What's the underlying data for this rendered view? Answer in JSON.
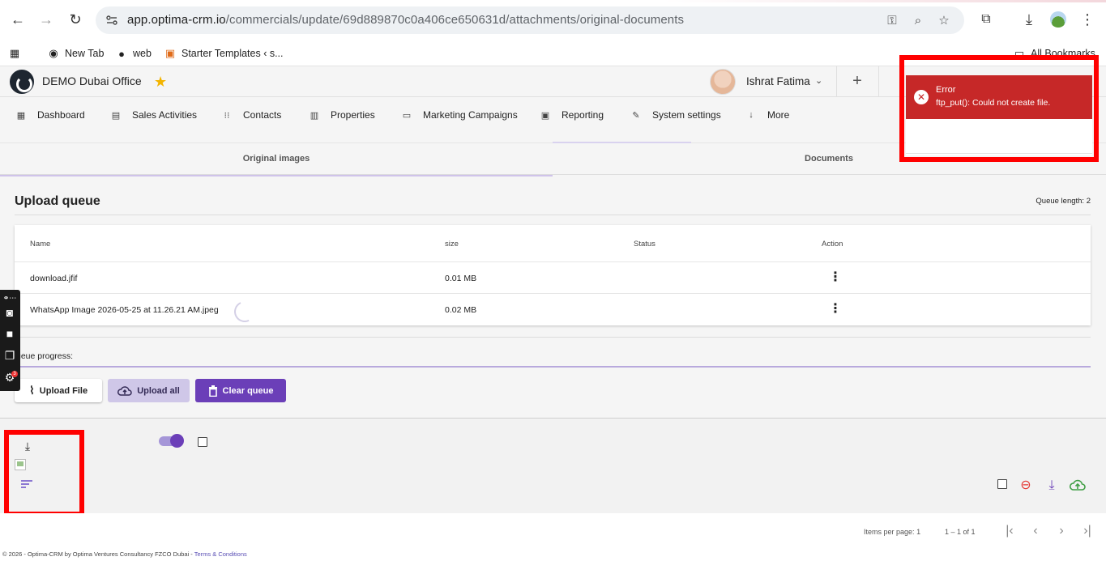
{
  "browser": {
    "url_host": "app.optima-crm.io",
    "url_path": "/commercials/update/69d889870c0a406ce650631d/attachments/original-documents",
    "bookmarks": [
      "New Tab",
      "web",
      "Starter Templates ‹ s..."
    ],
    "all_bookmarks": "All Bookmarks"
  },
  "app": {
    "office_name": "DEMO Dubai Office",
    "user_name": "Ishrat Fatima"
  },
  "nav": {
    "items": [
      {
        "label": "Dashboard",
        "icon": "dashboard-icon"
      },
      {
        "label": "Sales Activities",
        "icon": "clipboard-icon"
      },
      {
        "label": "Contacts",
        "icon": "grid-icon"
      },
      {
        "label": "Properties",
        "icon": "building-icon"
      },
      {
        "label": "Marketing Campaigns",
        "icon": "chat-icon"
      },
      {
        "label": "Reporting",
        "icon": "chart-icon"
      },
      {
        "label": "System settings",
        "icon": "settings-icon"
      },
      {
        "label": "More",
        "icon": "arrow-down-icon"
      }
    ]
  },
  "tabs": {
    "original_images": "Original images",
    "documents": "Documents"
  },
  "upload_queue": {
    "title": "Upload queue",
    "queue_length": "Queue length: 2",
    "columns": {
      "name": "Name",
      "size": "size",
      "status": "Status",
      "action": "Action"
    },
    "rows": [
      {
        "name": "download.jfif",
        "size": "0.01 MB",
        "status": ""
      },
      {
        "name": "WhatsApp Image 2026-05-25 at 11.26.21 AM.jpeg",
        "size": "0.02 MB",
        "status": ""
      }
    ],
    "progress_label": "ueue progress:",
    "progress": 1.0,
    "buttons": {
      "upload_file": "Upload File",
      "upload_all": "Upload all",
      "clear_queue": "Clear queue"
    }
  },
  "pager": {
    "items_per_page_label": "Items per page:",
    "items_per_page": "1",
    "range": "1 – 1 of 1"
  },
  "footer": {
    "text": "© 2026 - Optima-CRM by Optima Ventures Consultancy FZCO Dubai - ",
    "link": "Terms & Conditions"
  },
  "sidetool": {
    "badge": "3"
  },
  "toast": {
    "title": "Error",
    "message": "ftp_put(): Could not create file."
  },
  "colors": {
    "accent": "#6b3fb8",
    "error": "#c62828",
    "highlight": "#ff0000"
  }
}
